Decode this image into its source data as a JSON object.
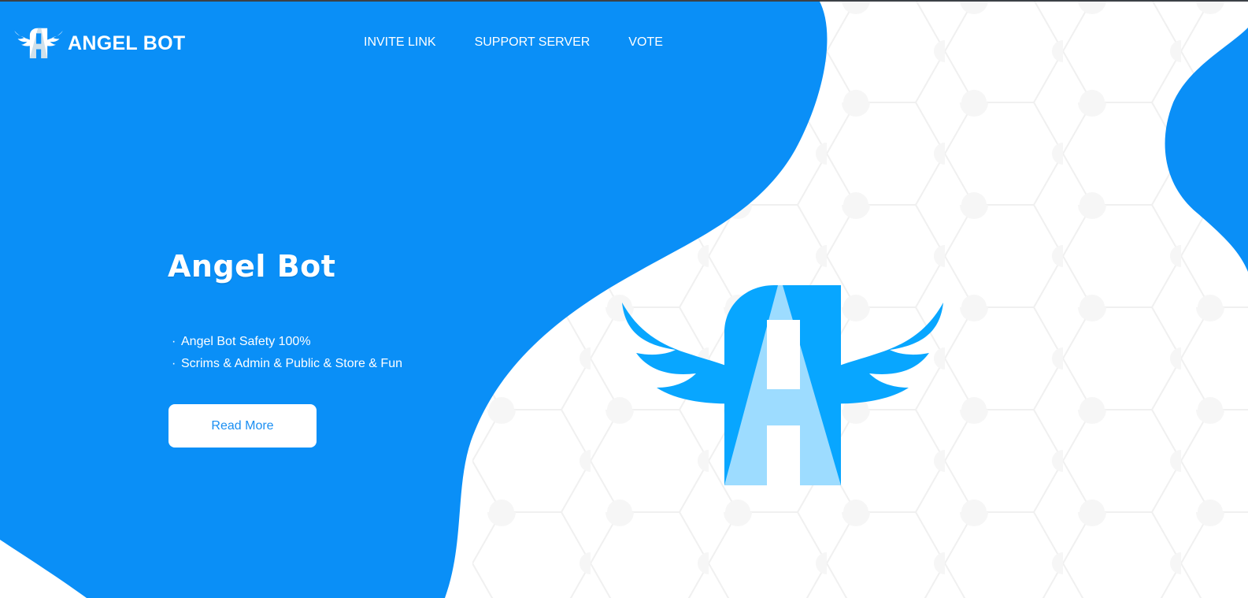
{
  "brand": {
    "name": "ANGEL BOT",
    "logo_icon": "angel-wings-a-icon"
  },
  "nav": {
    "items": [
      {
        "label": "INVITE LINK"
      },
      {
        "label": "SUPPORT SERVER"
      },
      {
        "label": "VOTE"
      }
    ]
  },
  "hero": {
    "title": "Angel Bot",
    "features": [
      "Angel Bot Safety 100%",
      "Scrims & Admin & Public & Store & Fun"
    ],
    "bullet": "·",
    "button_label": "Read More",
    "illustration_icon": "angel-wings-a-logo-icon"
  },
  "colors": {
    "primary_blue": "#0a8ff7",
    "logo_blue": "#08a6ff",
    "logo_light": "#9ddcff",
    "button_text": "#1a8ef2",
    "pattern_gray": "#d9d9d9"
  }
}
